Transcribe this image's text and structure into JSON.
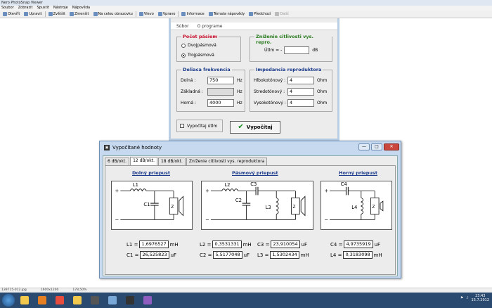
{
  "host": {
    "title": "Nero PhotoSnap Viewer",
    "menu": [
      "Soubor",
      "Zobrazit",
      "Spustit",
      "Nástroje",
      "Nápověda"
    ],
    "toolbar": [
      {
        "label": "Otevřít",
        "icon": "open-folder-icon"
      },
      {
        "label": "Upravit",
        "icon": "edit-icon"
      },
      {
        "label": "Zvětšit",
        "icon": "zoom-in-icon"
      },
      {
        "label": "Zmenšit",
        "icon": "zoom-out-icon"
      },
      {
        "label": "Na celou obrazovku",
        "icon": "fullscreen-icon"
      },
      {
        "label": "Vlevo",
        "icon": "rotate-left-icon"
      },
      {
        "label": "Vpravo",
        "icon": "rotate-right-icon"
      },
      {
        "label": "Informace",
        "icon": "info-icon"
      },
      {
        "label": "Témata nápovědy",
        "icon": "help-icon"
      },
      {
        "label": "Předchozí",
        "icon": "prev-icon"
      },
      {
        "label": "Další",
        "icon": "next-icon"
      }
    ],
    "status": {
      "file": "139715-012.jpg",
      "size": "1600x1200",
      "zoom": "178,50%"
    }
  },
  "form": {
    "menu": [
      "Súbor",
      "O programe"
    ],
    "bands_group": {
      "title": "Počet pásiem",
      "options": [
        {
          "label": "Dvojpásmová",
          "selected": false
        },
        {
          "label": "Trojpásmová",
          "selected": true
        }
      ]
    },
    "attenuation_group": {
      "title": "Zníženie citlivosti vys. repro.",
      "label": "Útlm = -",
      "value": "",
      "unit": "dB"
    },
    "crossover_group": {
      "title": "Deliaca frekvencia",
      "rows": [
        {
          "label": "Dolná :",
          "value": "750",
          "unit": "Hz",
          "disabled": false
        },
        {
          "label": "Základná :",
          "value": "",
          "unit": "Hz",
          "disabled": true
        },
        {
          "label": "Horná :",
          "value": "4000",
          "unit": "Hz",
          "disabled": false
        }
      ]
    },
    "impedance_group": {
      "title": "Impedancia reproduktora",
      "rows": [
        {
          "label": "Hlbokotónový :",
          "value": "4",
          "unit": "Ohm"
        },
        {
          "label": "Stredotónový :",
          "value": "4",
          "unit": "Ohm"
        },
        {
          "label": "Vysokotónový :",
          "value": "4",
          "unit": "Ohm"
        }
      ]
    },
    "calc_attenuation_label": "Vypočítaj útlm",
    "calc_button_label": "Vypočítaj"
  },
  "results": {
    "title": "Vypočítané hodnoty",
    "controls": {
      "minimize": "—",
      "maximize": "□",
      "close": "✕"
    },
    "tabs": [
      {
        "label": "6 dB/okt.",
        "active": false
      },
      {
        "label": "12 dB/okt.",
        "active": true
      },
      {
        "label": "18 dB/okt.",
        "active": false
      },
      {
        "label": "Zníženie citlivosti vys. reproduktora",
        "active": false
      }
    ],
    "low_pass": {
      "title": "Dolný priepust",
      "components": {
        "l": "L1",
        "c": "C1",
        "z": "Z"
      },
      "values": [
        {
          "label": "L1 =",
          "value": "1,6976527",
          "unit": "mH"
        },
        {
          "label": "C1 =",
          "value": "26,525823",
          "unit": "uF"
        }
      ]
    },
    "band_pass": {
      "title": "Pásmový priepust",
      "components": {
        "l_series": "L2",
        "c_series": "C3",
        "c_shunt": "C2",
        "l_shunt": "L3",
        "z": "Z"
      },
      "values": [
        {
          "label": "L2 =",
          "value": "0,3531331",
          "unit": "mH"
        },
        {
          "label": "C3 =",
          "value": "23,910054",
          "unit": "uF"
        },
        {
          "label": "C2 =",
          "value": "5,5177048",
          "unit": "uF"
        },
        {
          "label": "L3 =",
          "value": "1,5302434",
          "unit": "mH"
        }
      ]
    },
    "high_pass": {
      "title": "Horný priepust",
      "components": {
        "c": "C4",
        "l": "L4",
        "z": "Z"
      },
      "values": [
        {
          "label": "C4 =",
          "value": "4,9735919",
          "unit": "uF"
        },
        {
          "label": "L4 =",
          "value": "0,3183098",
          "unit": "mH"
        }
      ]
    },
    "polarity": {
      "plus": "+",
      "minus": "−"
    }
  },
  "taskbar": {
    "apps": [
      "explorer-icon",
      "media-player-icon",
      "chrome-icon",
      "folder-icon",
      "app-icon",
      "calculator-icon",
      "terminal-icon",
      "photo-viewer-icon"
    ],
    "app_colors": [
      "#f2c94c",
      "#e67e22",
      "#e74c3c",
      "#f2c94c",
      "#555555",
      "#7aa9d8",
      "#333333",
      "#8e5dbf"
    ],
    "time": "23:43",
    "date": "15.7.2012"
  }
}
